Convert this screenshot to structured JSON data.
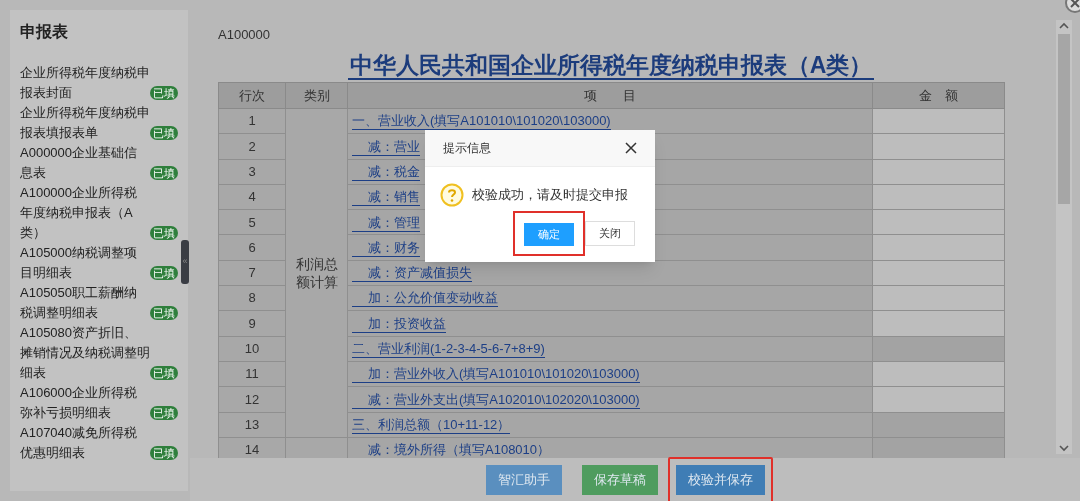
{
  "sidebar": {
    "title": "申报表",
    "items": [
      {
        "label": "企业所得税年度纳税申报表封面",
        "badge": "已填"
      },
      {
        "label": "企业所得税年度纳税申报表填报表单",
        "badge": "已填"
      },
      {
        "label": "A000000企业基础信息表",
        "badge": "已填"
      },
      {
        "label": "A100000企业所得税年度纳税申报表（A类）",
        "badge": "已填"
      },
      {
        "label": "A105000纳税调整项目明细表",
        "badge": "已填"
      },
      {
        "label": "A105050职工薪酬纳税调整明细表",
        "badge": "已填"
      },
      {
        "label": "A105080资产折旧、摊销情况及纳税调整明细表",
        "badge": "已填"
      },
      {
        "label": "A106000企业所得税弥补亏损明细表",
        "badge": "已填"
      },
      {
        "label": "A107040减免所得税优惠明细表",
        "badge": "已填"
      }
    ],
    "collapse": "«"
  },
  "form": {
    "code": "A100000",
    "title": "中华人民共和国企业所得税年度纳税申报表（A类）",
    "columns": [
      "行次",
      "类别",
      "项　　目",
      "金　额"
    ],
    "groups": [
      {
        "category": "利润总额计算",
        "rows": [
          {
            "no": "1",
            "item": "一、营业收入(填写A101010\\101020\\103000)",
            "kind": "main",
            "editable": true
          },
          {
            "no": "2",
            "item": "减：营业",
            "kind": "sub",
            "editable": true
          },
          {
            "no": "3",
            "item": "减：税金",
            "kind": "sub",
            "editable": true
          },
          {
            "no": "4",
            "item": "减：销售",
            "kind": "sub",
            "editable": true
          },
          {
            "no": "5",
            "item": "减：管理",
            "kind": "sub",
            "editable": true
          },
          {
            "no": "6",
            "item": "减：财务",
            "kind": "sub",
            "editable": true
          },
          {
            "no": "7",
            "item": "减：资产减值损失",
            "kind": "sub",
            "editable": true
          },
          {
            "no": "8",
            "item": "加：公允价值变动收益",
            "kind": "sub",
            "editable": true
          },
          {
            "no": "9",
            "item": "加：投资收益",
            "kind": "sub",
            "editable": true
          },
          {
            "no": "10",
            "item": "二、营业利润(1-2-3-4-5-6-7+8+9)",
            "kind": "main",
            "editable": false
          },
          {
            "no": "11",
            "item": "加：营业外收入(填写A101010\\101020\\103000)",
            "kind": "sub",
            "editable": true
          },
          {
            "no": "12",
            "item": "减：营业外支出(填写A102010\\102020\\103000)",
            "kind": "sub",
            "editable": true
          },
          {
            "no": "13",
            "item": "三、利润总额（10+11-12）",
            "kind": "main",
            "editable": false
          }
        ]
      },
      {
        "rows": [
          {
            "no": "14",
            "item": "减：境外所得（填写A108010）",
            "kind": "sub",
            "editable": false
          }
        ]
      }
    ]
  },
  "actions": [
    {
      "label": "智汇助手",
      "kind": "assist",
      "highlighted": false
    },
    {
      "label": "保存草稿",
      "kind": "draft",
      "highlighted": false
    },
    {
      "label": "校验并保存",
      "kind": "verify",
      "highlighted": true
    }
  ],
  "dialog": {
    "title": "提示信息",
    "message": "校验成功，请及时提交申报",
    "buttons": [
      {
        "label": "确定",
        "kind": "primary",
        "highlighted": true
      },
      {
        "label": "关闭",
        "kind": "default",
        "highlighted": false
      }
    ]
  }
}
